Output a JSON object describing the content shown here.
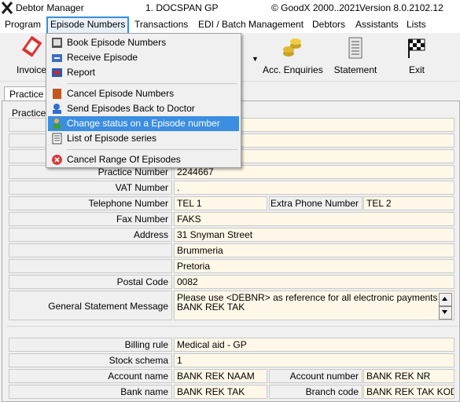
{
  "titlebar": {
    "app_title": "Debtor Manager",
    "document": "1. DOCSPAN GP",
    "copyright": "© GoodX 2000..2021",
    "version": "Version 8.0.2102.12"
  },
  "menubar": {
    "items": [
      "Program",
      "Episode Numbers",
      "Transactions",
      "EDI / Batch Management",
      "Debtors",
      "Assistants",
      "Lists"
    ],
    "active_index": 1
  },
  "toolbar": {
    "invoice_label": "Invoice",
    "acc_enquiries_label": "Acc. Enquiries",
    "statement_label": "Statement",
    "exit_label": "Exit"
  },
  "tabs": {
    "active_tab": "Practice In",
    "group_title": "Practice I"
  },
  "dropdown": {
    "items": [
      {
        "label": "Book Episode Numbers",
        "icon": "book-icon"
      },
      {
        "label": "Receive Episode",
        "icon": "receive-icon"
      },
      {
        "label": "Report",
        "icon": "report-icon"
      },
      {
        "label": "Cancel Episode Numbers",
        "icon": "cancel-book-icon"
      },
      {
        "label": "Send Episodes Back to Doctor",
        "icon": "send-back-icon"
      },
      {
        "label": "Change status on a Episode number",
        "icon": "user-status-icon"
      },
      {
        "label": "List of Episode series",
        "icon": "list-icon"
      },
      {
        "label": "Cancel Range Of Episodes",
        "icon": "cancel-range-icon"
      }
    ],
    "highlighted_index": 5
  },
  "form": {
    "practice_number_label": "Practice Number",
    "practice_number": "2244667",
    "vat_number_label": "VAT Number",
    "vat_number": ".",
    "telephone_label": "Telephone Number",
    "telephone": "TEL 1",
    "extra_phone_label": "Extra Phone Number",
    "extra_phone": "TEL 2",
    "fax_label": "Fax Number",
    "fax": "FAKS",
    "address_label": "Address",
    "address_1": "31 Snyman Street",
    "address_2": "Brummeria",
    "address_3": "Pretoria",
    "postal_code_label": "Postal Code",
    "postal_code": "0082",
    "gsm_label": "General Statement Message",
    "gsm_line_1": "Please use <DEBNR> as reference  for all electronic payments",
    "gsm_line_2": "BANK REK TAK",
    "billing_rule_label": "Billing rule",
    "billing_rule": "Medical aid - GP",
    "stock_schema_label": "Stock schema",
    "stock_schema": "1",
    "account_name_label": "Account name",
    "account_name": "BANK REK NAAM",
    "account_number_label": "Account number",
    "account_number": "BANK REK NR",
    "bank_name_label": "Bank name",
    "bank_name": "BANK REK TAK",
    "branch_code_label": "Branch code",
    "branch_code": "BANK REK TAK KODE"
  },
  "colors": {
    "field_bg": "#fff8e8",
    "highlight": "#3b8ee0",
    "active_menu_border": "#3c8fd6"
  }
}
